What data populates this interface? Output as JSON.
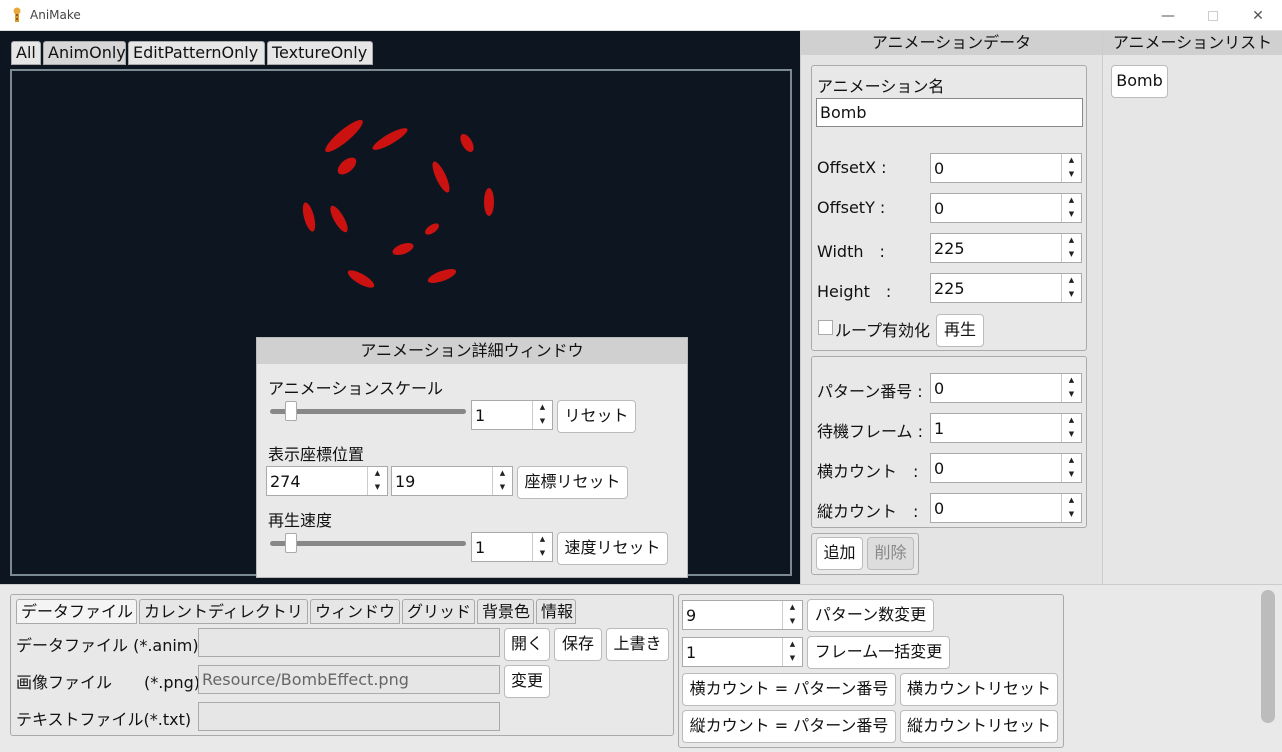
{
  "window": {
    "title": "AniMake",
    "minimize_icon": "minimize-icon",
    "maximize_icon": "maximize-icon",
    "close_icon": "close-icon"
  },
  "view_tabs": [
    "All",
    "AnimOnly",
    "EditPatternOnly",
    "TextureOnly"
  ],
  "detail_window": {
    "title": "アニメーション詳細ウィンドウ",
    "scale_label": "アニメーションスケール",
    "scale_value": "1",
    "scale_reset": "リセット",
    "position_label": "表示座標位置",
    "pos_x": "274",
    "pos_y": "19",
    "position_reset": "座標リセット",
    "speed_label": "再生速度",
    "speed_value": "1",
    "speed_reset": "速度リセット"
  },
  "anim_data": {
    "header": "アニメーションデータ",
    "name_label": "アニメーション名",
    "name_value": "Bomb",
    "offset_x_label": "OffsetX :",
    "offset_x": "0",
    "offset_y_label": "OffsetY :",
    "offset_y": "0",
    "width_label": "Width　:",
    "width": "225",
    "height_label": "Height　:",
    "height": "225",
    "loop_label": "ループ有効化",
    "play_button": "再生",
    "pattern_no_label": "パターン番号 :",
    "pattern_no": "0",
    "wait_frame_label": "待機フレーム :",
    "wait_frame": "1",
    "h_count_label": "横カウント　:",
    "h_count": "0",
    "v_count_label": "縦カウント　:",
    "v_count": "0",
    "add_button": "追加",
    "delete_button": "削除"
  },
  "anim_list": {
    "header": "アニメーションリスト",
    "items": [
      "Bomb"
    ]
  },
  "bottom_tabs": [
    "データファイル",
    "カレントディレクトリ",
    "ウィンドウ",
    "グリッド",
    "背景色",
    "情報"
  ],
  "files": {
    "data_label": "データファイル (*.anim)",
    "data_value": "",
    "open_button": "開く",
    "save_button": "保存",
    "overwrite_button": "上書き",
    "image_label": "画像ファイル　　(*.png)",
    "image_value": "Resource/BombEffect.png",
    "change_button": "変更",
    "text_label": "テキストファイル(*.txt)",
    "text_value": ""
  },
  "pattern_tools": {
    "pattern_count": "9",
    "pattern_count_button": "パターン数変更",
    "frame_value": "1",
    "frame_button": "フレーム一括変更",
    "h_eq_button": "横カウント = パターン番号",
    "h_reset_button": "横カウントリセット",
    "v_eq_button": "縦カウント = パターン番号",
    "v_reset_button": "縦カウントリセット"
  },
  "colors": {
    "canvas_bg": "#0d1620",
    "sprite_red": "#cc1111"
  }
}
